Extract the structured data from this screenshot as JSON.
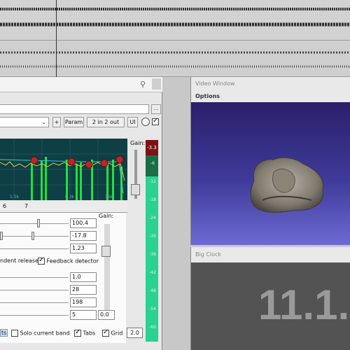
{
  "fx": {
    "buttons": {
      "plus": "+",
      "param": "Param",
      "io": "2 in 2 out",
      "ui": "UI",
      "browse": "..."
    },
    "graph": {
      "gain_label": "Gain:",
      "meter_top": "-3.3",
      "freq_labels": [
        "1.5k",
        "6.3k",
        "16k"
      ],
      "gain_level_percent": 18
    },
    "band_tabs": [
      "6",
      "7"
    ],
    "params": {
      "p1": "100.4",
      "p2": "-17.8",
      "p3": "1.23",
      "p4": "1.0",
      "p5": "28",
      "p6": "198",
      "p7": "5",
      "p8": "0.0"
    },
    "panel_gain_label": "Gain:",
    "options": {
      "release": "ndent release",
      "feedback": "Feedback detector",
      "solo_prefix": "ts",
      "solo": "Solo current band",
      "tabs": "Tabs",
      "grid": "Grid",
      "grid_value": "2.0"
    },
    "meter_scale": [
      "-6",
      "-12",
      "-18",
      "-24",
      "-30",
      "-36",
      "-42",
      "-48",
      "-54",
      "-60"
    ]
  },
  "video": {
    "title": "Video Window",
    "options": "Options"
  },
  "clock": {
    "title": "Big Clock",
    "time": "11.1."
  },
  "colors": {
    "graph_bg": "#0d3f44",
    "meter_green": "#29d28f",
    "video_blue": "#3f3b9a",
    "clock_bg": "#535353"
  }
}
